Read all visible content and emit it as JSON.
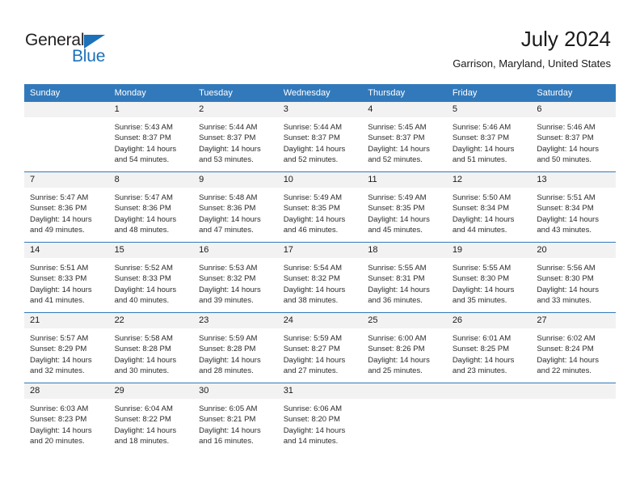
{
  "logo": {
    "primary_text": "General",
    "secondary_text": "Blue",
    "primary_color": "#231f20",
    "secondary_color": "#1c71b9"
  },
  "header": {
    "title": "July 2024",
    "location": "Garrison, Maryland, United States"
  },
  "theme": {
    "header_row_bg": "#3279bb",
    "daynum_band_bg": "#f2f2f2",
    "week_divider": "#3279bb",
    "text": "#1a1a1a"
  },
  "columns": [
    "Sunday",
    "Monday",
    "Tuesday",
    "Wednesday",
    "Thursday",
    "Friday",
    "Saturday"
  ],
  "weeks": [
    [
      {
        "day": "",
        "empty": true
      },
      {
        "day": "1",
        "sunrise": "Sunrise: 5:43 AM",
        "sunset": "Sunset: 8:37 PM",
        "daylight_line1": "Daylight: 14 hours",
        "daylight_line2": "and 54 minutes."
      },
      {
        "day": "2",
        "sunrise": "Sunrise: 5:44 AM",
        "sunset": "Sunset: 8:37 PM",
        "daylight_line1": "Daylight: 14 hours",
        "daylight_line2": "and 53 minutes."
      },
      {
        "day": "3",
        "sunrise": "Sunrise: 5:44 AM",
        "sunset": "Sunset: 8:37 PM",
        "daylight_line1": "Daylight: 14 hours",
        "daylight_line2": "and 52 minutes."
      },
      {
        "day": "4",
        "sunrise": "Sunrise: 5:45 AM",
        "sunset": "Sunset: 8:37 PM",
        "daylight_line1": "Daylight: 14 hours",
        "daylight_line2": "and 52 minutes."
      },
      {
        "day": "5",
        "sunrise": "Sunrise: 5:46 AM",
        "sunset": "Sunset: 8:37 PM",
        "daylight_line1": "Daylight: 14 hours",
        "daylight_line2": "and 51 minutes."
      },
      {
        "day": "6",
        "sunrise": "Sunrise: 5:46 AM",
        "sunset": "Sunset: 8:37 PM",
        "daylight_line1": "Daylight: 14 hours",
        "daylight_line2": "and 50 minutes."
      }
    ],
    [
      {
        "day": "7",
        "sunrise": "Sunrise: 5:47 AM",
        "sunset": "Sunset: 8:36 PM",
        "daylight_line1": "Daylight: 14 hours",
        "daylight_line2": "and 49 minutes."
      },
      {
        "day": "8",
        "sunrise": "Sunrise: 5:47 AM",
        "sunset": "Sunset: 8:36 PM",
        "daylight_line1": "Daylight: 14 hours",
        "daylight_line2": "and 48 minutes."
      },
      {
        "day": "9",
        "sunrise": "Sunrise: 5:48 AM",
        "sunset": "Sunset: 8:36 PM",
        "daylight_line1": "Daylight: 14 hours",
        "daylight_line2": "and 47 minutes."
      },
      {
        "day": "10",
        "sunrise": "Sunrise: 5:49 AM",
        "sunset": "Sunset: 8:35 PM",
        "daylight_line1": "Daylight: 14 hours",
        "daylight_line2": "and 46 minutes."
      },
      {
        "day": "11",
        "sunrise": "Sunrise: 5:49 AM",
        "sunset": "Sunset: 8:35 PM",
        "daylight_line1": "Daylight: 14 hours",
        "daylight_line2": "and 45 minutes."
      },
      {
        "day": "12",
        "sunrise": "Sunrise: 5:50 AM",
        "sunset": "Sunset: 8:34 PM",
        "daylight_line1": "Daylight: 14 hours",
        "daylight_line2": "and 44 minutes."
      },
      {
        "day": "13",
        "sunrise": "Sunrise: 5:51 AM",
        "sunset": "Sunset: 8:34 PM",
        "daylight_line1": "Daylight: 14 hours",
        "daylight_line2": "and 43 minutes."
      }
    ],
    [
      {
        "day": "14",
        "sunrise": "Sunrise: 5:51 AM",
        "sunset": "Sunset: 8:33 PM",
        "daylight_line1": "Daylight: 14 hours",
        "daylight_line2": "and 41 minutes."
      },
      {
        "day": "15",
        "sunrise": "Sunrise: 5:52 AM",
        "sunset": "Sunset: 8:33 PM",
        "daylight_line1": "Daylight: 14 hours",
        "daylight_line2": "and 40 minutes."
      },
      {
        "day": "16",
        "sunrise": "Sunrise: 5:53 AM",
        "sunset": "Sunset: 8:32 PM",
        "daylight_line1": "Daylight: 14 hours",
        "daylight_line2": "and 39 minutes."
      },
      {
        "day": "17",
        "sunrise": "Sunrise: 5:54 AM",
        "sunset": "Sunset: 8:32 PM",
        "daylight_line1": "Daylight: 14 hours",
        "daylight_line2": "and 38 minutes."
      },
      {
        "day": "18",
        "sunrise": "Sunrise: 5:55 AM",
        "sunset": "Sunset: 8:31 PM",
        "daylight_line1": "Daylight: 14 hours",
        "daylight_line2": "and 36 minutes."
      },
      {
        "day": "19",
        "sunrise": "Sunrise: 5:55 AM",
        "sunset": "Sunset: 8:30 PM",
        "daylight_line1": "Daylight: 14 hours",
        "daylight_line2": "and 35 minutes."
      },
      {
        "day": "20",
        "sunrise": "Sunrise: 5:56 AM",
        "sunset": "Sunset: 8:30 PM",
        "daylight_line1": "Daylight: 14 hours",
        "daylight_line2": "and 33 minutes."
      }
    ],
    [
      {
        "day": "21",
        "sunrise": "Sunrise: 5:57 AM",
        "sunset": "Sunset: 8:29 PM",
        "daylight_line1": "Daylight: 14 hours",
        "daylight_line2": "and 32 minutes."
      },
      {
        "day": "22",
        "sunrise": "Sunrise: 5:58 AM",
        "sunset": "Sunset: 8:28 PM",
        "daylight_line1": "Daylight: 14 hours",
        "daylight_line2": "and 30 minutes."
      },
      {
        "day": "23",
        "sunrise": "Sunrise: 5:59 AM",
        "sunset": "Sunset: 8:28 PM",
        "daylight_line1": "Daylight: 14 hours",
        "daylight_line2": "and 28 minutes."
      },
      {
        "day": "24",
        "sunrise": "Sunrise: 5:59 AM",
        "sunset": "Sunset: 8:27 PM",
        "daylight_line1": "Daylight: 14 hours",
        "daylight_line2": "and 27 minutes."
      },
      {
        "day": "25",
        "sunrise": "Sunrise: 6:00 AM",
        "sunset": "Sunset: 8:26 PM",
        "daylight_line1": "Daylight: 14 hours",
        "daylight_line2": "and 25 minutes."
      },
      {
        "day": "26",
        "sunrise": "Sunrise: 6:01 AM",
        "sunset": "Sunset: 8:25 PM",
        "daylight_line1": "Daylight: 14 hours",
        "daylight_line2": "and 23 minutes."
      },
      {
        "day": "27",
        "sunrise": "Sunrise: 6:02 AM",
        "sunset": "Sunset: 8:24 PM",
        "daylight_line1": "Daylight: 14 hours",
        "daylight_line2": "and 22 minutes."
      }
    ],
    [
      {
        "day": "28",
        "sunrise": "Sunrise: 6:03 AM",
        "sunset": "Sunset: 8:23 PM",
        "daylight_line1": "Daylight: 14 hours",
        "daylight_line2": "and 20 minutes."
      },
      {
        "day": "29",
        "sunrise": "Sunrise: 6:04 AM",
        "sunset": "Sunset: 8:22 PM",
        "daylight_line1": "Daylight: 14 hours",
        "daylight_line2": "and 18 minutes."
      },
      {
        "day": "30",
        "sunrise": "Sunrise: 6:05 AM",
        "sunset": "Sunset: 8:21 PM",
        "daylight_line1": "Daylight: 14 hours",
        "daylight_line2": "and 16 minutes."
      },
      {
        "day": "31",
        "sunrise": "Sunrise: 6:06 AM",
        "sunset": "Sunset: 8:20 PM",
        "daylight_line1": "Daylight: 14 hours",
        "daylight_line2": "and 14 minutes."
      },
      {
        "day": "",
        "empty": true
      },
      {
        "day": "",
        "empty": true
      },
      {
        "day": "",
        "empty": true
      }
    ]
  ]
}
